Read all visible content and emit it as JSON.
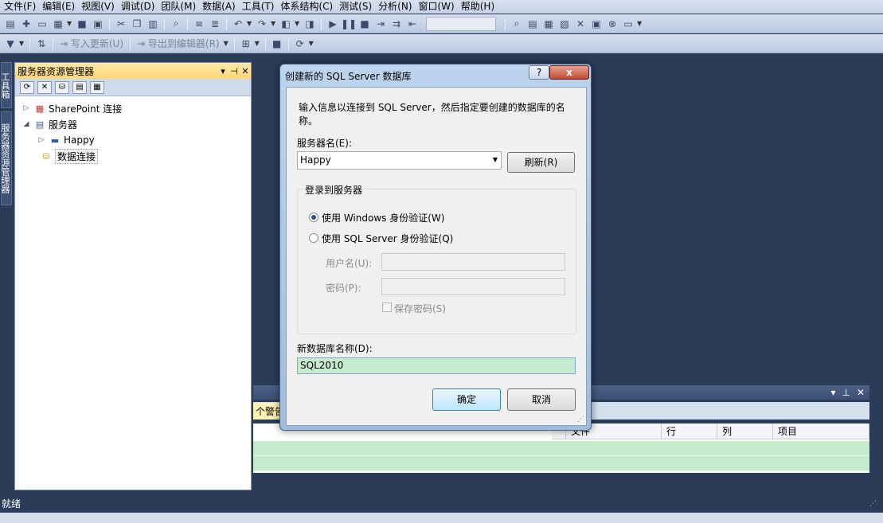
{
  "menu": [
    "文件(F)",
    "编辑(E)",
    "视图(V)",
    "调试(D)",
    "团队(M)",
    "数据(A)",
    "工具(T)",
    "体系结构(C)",
    "测试(S)",
    "分析(N)",
    "窗口(W)",
    "帮助(H)"
  ],
  "toolbar2": {
    "write_update": "写入更新(U)",
    "export_editor": "导出到编辑器(R)"
  },
  "side_tabs": [
    "工具箱",
    "服务器资源管理器"
  ],
  "server_explorer": {
    "title": "服务器资源管理器",
    "nodes": [
      {
        "label": "SharePoint 连接"
      },
      {
        "label": "服务器"
      },
      {
        "label": "Happy"
      },
      {
        "label": "数据连接"
      }
    ]
  },
  "error_list": {
    "warnings_tab": "个警告",
    "columns": [
      "文件",
      "行",
      "列",
      "项目"
    ]
  },
  "status": {
    "text": "就绪"
  },
  "dialog": {
    "title": "创建新的 SQL Server 数据库",
    "help_btn": "?",
    "close_btn": "x",
    "instruction": "输入信息以连接到 SQL Server，然后指定要创建的数据库的名称。",
    "server_label": "服务器名(E):",
    "server_value": "Happy",
    "refresh_btn": "刷新(R)",
    "login_group": "登录到服务器",
    "windows_auth": "使用 Windows 身份验证(W)",
    "sql_auth": "使用 SQL Server 身份验证(Q)",
    "username_label": "用户名(U):",
    "password_label": "密码(P):",
    "save_password": "保存密码(S)",
    "dbname_label": "新数据库名称(D):",
    "dbname_value": "SQL2010",
    "ok_btn": "确定",
    "cancel_btn": "取消"
  }
}
